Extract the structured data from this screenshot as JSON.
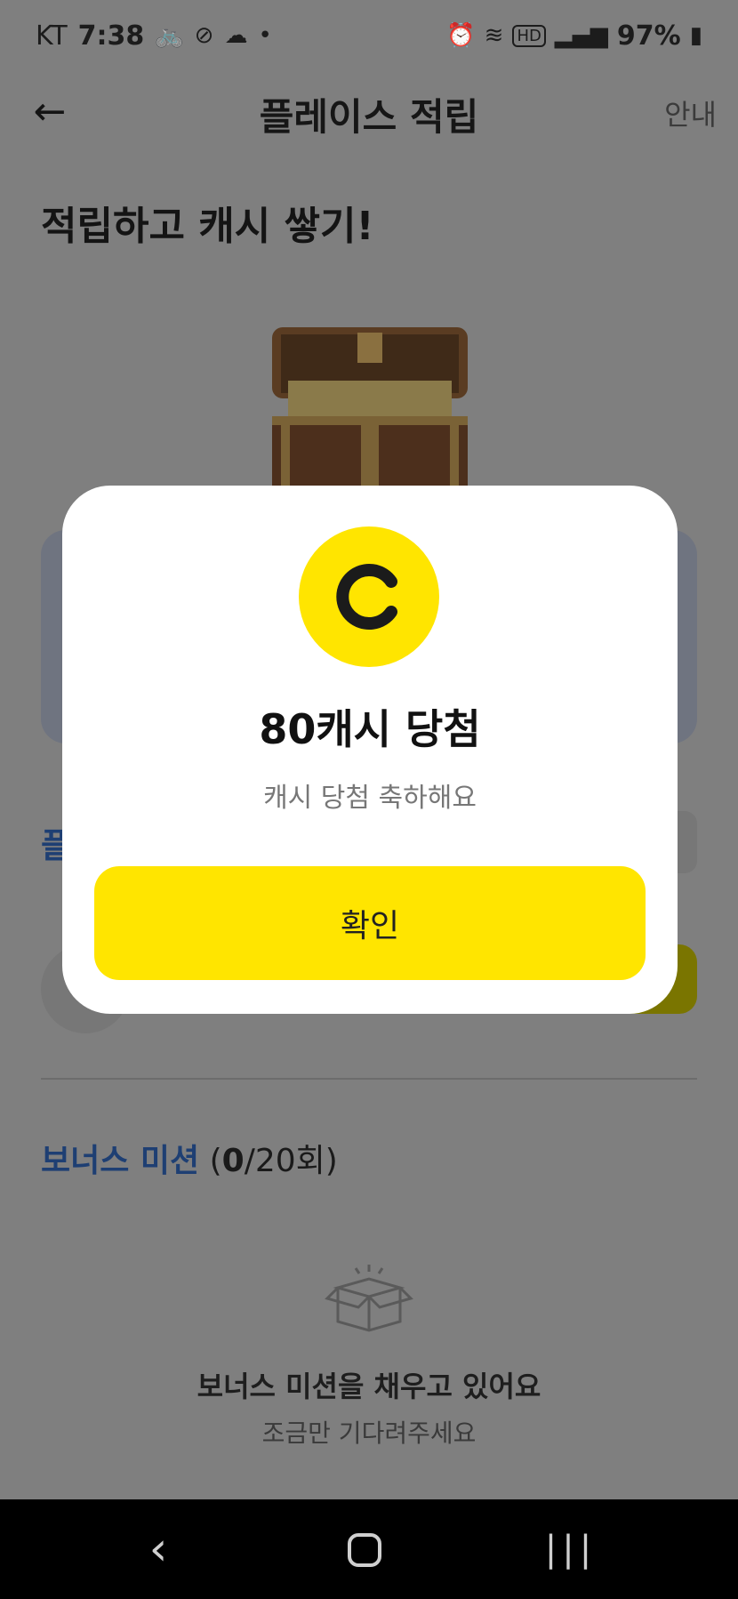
{
  "status_bar": {
    "carrier": "KT",
    "time": "7:38",
    "battery": "97%",
    "icons_left": [
      "bike-icon",
      "pill-icon",
      "cloud-icon",
      "dot-icon"
    ],
    "icons_right": [
      "alarm-icon",
      "wifi-icon",
      "hd-icon",
      "signal-icon",
      "battery-icon"
    ]
  },
  "header": {
    "title": "플레이스 적립",
    "guide_label": "안내"
  },
  "page": {
    "headline": "적립하고 캐시 쌓기!",
    "partial_section_text": "플",
    "bonus": {
      "title": "보너스 미션",
      "count_open": "(",
      "count_current": "0",
      "count_total": "/20회)"
    },
    "empty_state": {
      "title": "보너스 미션을 채우고 있어요",
      "subtitle": "조금만 기다려주세요"
    }
  },
  "modal": {
    "coin_letter": "C",
    "title": "80캐시 당첨",
    "subtitle": "캐시 당첨 축하해요",
    "confirm_label": "확인"
  },
  "colors": {
    "accent_yellow": "#ffe500",
    "link_blue": "#1e3f73",
    "dim_overlay": "#7f7f7f"
  }
}
